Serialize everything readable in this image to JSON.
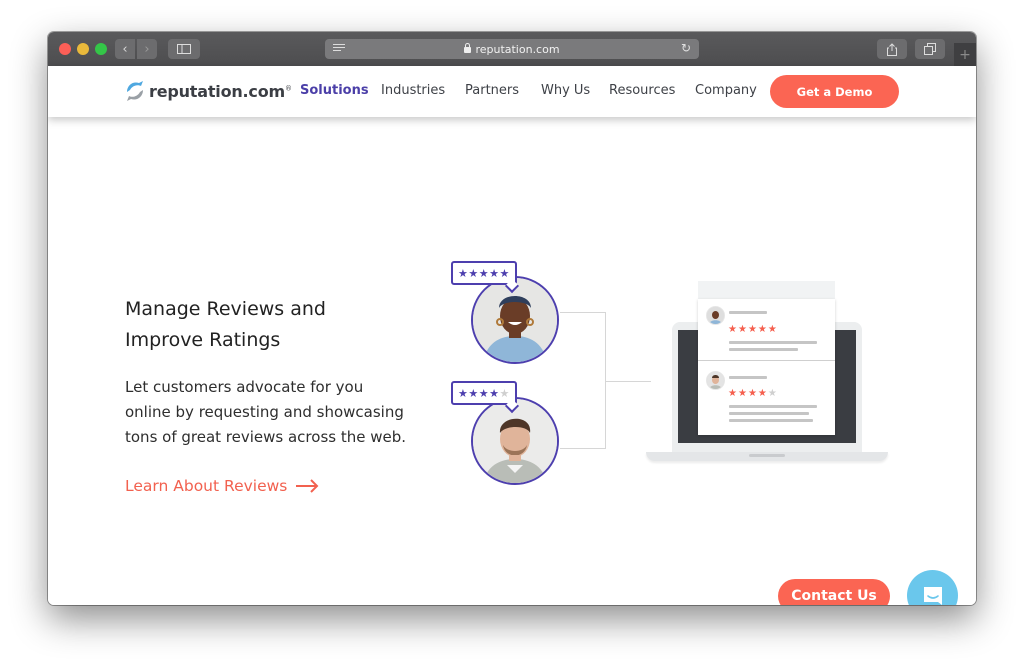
{
  "browser": {
    "url": "reputation.com",
    "back_icon": "chevron-left-icon",
    "forward_icon": "chevron-right-icon",
    "sidebar_icon": "sidebar-icon",
    "reader_icon": "reader-icon",
    "lock_icon": "lock-icon",
    "reload_icon": "reload-icon",
    "share_icon": "share-icon",
    "tabs_icon": "tabs-icon",
    "new_tab_label": "+"
  },
  "header": {
    "logo_text": "reputation.com",
    "logo_reg": "®",
    "nav": [
      {
        "label": "Solutions",
        "active": true
      },
      {
        "label": "Industries",
        "active": false
      },
      {
        "label": "Partners",
        "active": false
      },
      {
        "label": "Why Us",
        "active": false
      },
      {
        "label": "Resources",
        "active": false
      },
      {
        "label": "Company",
        "active": false
      }
    ],
    "cta_label": "Get a Demo"
  },
  "hero": {
    "headline_line1": "Manage Reviews and",
    "headline_line2": "Improve Ratings",
    "body_line1": "Let customers advocate for you",
    "body_line2": "online by requesting and showcasing",
    "body_line3": "tons of great reviews across the web.",
    "link_label": "Learn About Reviews"
  },
  "illustration": {
    "reviews": [
      {
        "reviewer": "woman",
        "rating": 5,
        "max": 5
      },
      {
        "reviewer": "man",
        "rating": 4,
        "max": 5
      }
    ]
  },
  "floating": {
    "contact_label": "Contact Us",
    "chat_icon": "chat-icon"
  },
  "colors": {
    "accent": "#fb6553",
    "brand_purple": "#4d3fae",
    "logo_blue": "#4fa8e0",
    "chat_blue": "#6ac7ec"
  }
}
